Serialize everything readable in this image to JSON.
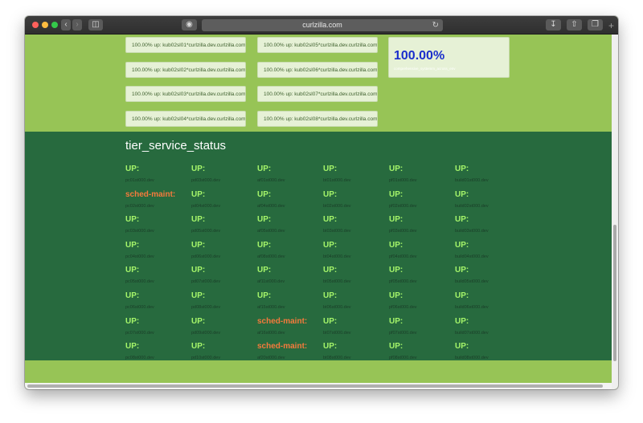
{
  "browser": {
    "url": "curlzilla.com"
  },
  "hosts": {
    "left": [
      "100.00% up: kub02sl01*curlzilla.dev.curlzilla.com",
      "100.00% up: kub02sl02*curlzilla.dev.curlzilla.com",
      "100.00% up: kub02sl03*curlzilla.dev.curlzilla.com",
      "100.00% up: kub02sl04*curlzilla.dev.curlzilla.com"
    ],
    "right": [
      "100.00% up: kub02sl05*curlzilla.dev.curlzilla.com",
      "100.00% up: kub02sl06*curlzilla.dev.curlzilla.com",
      "100.00% up: kub02sl07*curlzilla.dev.curlzilla.com",
      "100.00% up: kub02sl08*curlzilla.dev.curlzilla.com"
    ]
  },
  "summary": {
    "percent": "100.00%",
    "label": "comprehensive_systemm_across_env"
  },
  "tier": {
    "title": "tier_service_status",
    "columns": [
      [
        {
          "status": "UP:",
          "host": "pc01st000.dev"
        },
        {
          "status": "sched-maint:",
          "host": "pc02st000.dev"
        },
        {
          "status": "UP:",
          "host": "pc03st000.dev"
        },
        {
          "status": "UP:",
          "host": "pc04st000.dev"
        },
        {
          "status": "UP:",
          "host": "pc05st000.dev"
        },
        {
          "status": "UP:",
          "host": "pc06st000.dev"
        },
        {
          "status": "UP:",
          "host": "pc07st000.dev"
        },
        {
          "status": "UP:",
          "host": "pc08st000.dev"
        }
      ],
      [
        {
          "status": "UP:",
          "host": "pd03st000.dev"
        },
        {
          "status": "UP:",
          "host": "pd04st000.dev"
        },
        {
          "status": "UP:",
          "host": "pd05st000.dev"
        },
        {
          "status": "UP:",
          "host": "pd06st000.dev"
        },
        {
          "status": "UP:",
          "host": "pd07st000.dev"
        },
        {
          "status": "UP:",
          "host": "pd08st000.dev"
        },
        {
          "status": "UP:",
          "host": "pd09st000.dev"
        },
        {
          "status": "UP:",
          "host": "pd10st000.dev"
        }
      ],
      [
        {
          "status": "UP:",
          "host": "af01st000.dev"
        },
        {
          "status": "UP:",
          "host": "af04st000.dev"
        },
        {
          "status": "UP:",
          "host": "af05st000.dev"
        },
        {
          "status": "UP:",
          "host": "af08st000.dev"
        },
        {
          "status": "UP:",
          "host": "af11st000.dev"
        },
        {
          "status": "UP:",
          "host": "af15st000.dev"
        },
        {
          "status": "sched-maint:",
          "host": "af16st000.dev"
        },
        {
          "status": "sched-maint:",
          "host": "af20st000.dev"
        }
      ],
      [
        {
          "status": "UP:",
          "host": "bt01st000.dev"
        },
        {
          "status": "UP:",
          "host": "bt02st000.dev"
        },
        {
          "status": "UP:",
          "host": "bt03st000.dev"
        },
        {
          "status": "UP:",
          "host": "bt04st000.dev"
        },
        {
          "status": "UP:",
          "host": "bt05st000.dev"
        },
        {
          "status": "UP:",
          "host": "bt06st000.dev"
        },
        {
          "status": "UP:",
          "host": "bt07st000.dev"
        },
        {
          "status": "UP:",
          "host": "bt08st000.dev"
        }
      ],
      [
        {
          "status": "UP:",
          "host": "pf01st000.dev"
        },
        {
          "status": "UP:",
          "host": "pf02st000.dev"
        },
        {
          "status": "UP:",
          "host": "pf03st000.dev"
        },
        {
          "status": "UP:",
          "host": "pf04st000.dev"
        },
        {
          "status": "UP:",
          "host": "pf05st000.dev"
        },
        {
          "status": "UP:",
          "host": "pf06st000.dev"
        },
        {
          "status": "UP:",
          "host": "pf07st000.dev"
        },
        {
          "status": "UP:",
          "host": "pf08st000.dev"
        }
      ],
      [
        {
          "status": "UP:",
          "host": "build01st000.dev"
        },
        {
          "status": "UP:",
          "host": "build02st000.dev"
        },
        {
          "status": "UP:",
          "host": "build03st000.dev"
        },
        {
          "status": "UP:",
          "host": "build04st000.dev"
        },
        {
          "status": "UP:",
          "host": "build05st000.dev"
        },
        {
          "status": "UP:",
          "host": "build06st000.dev"
        },
        {
          "status": "UP:",
          "host": "build07st000.dev"
        },
        {
          "status": "UP:",
          "host": "build08st000.dev"
        }
      ]
    ]
  },
  "colors": {
    "page_green": "#97c456",
    "dark_green": "#276a3e",
    "up": "#a5f56a",
    "maint": "#f57a3c",
    "summary_blue": "#1b2fcc"
  }
}
